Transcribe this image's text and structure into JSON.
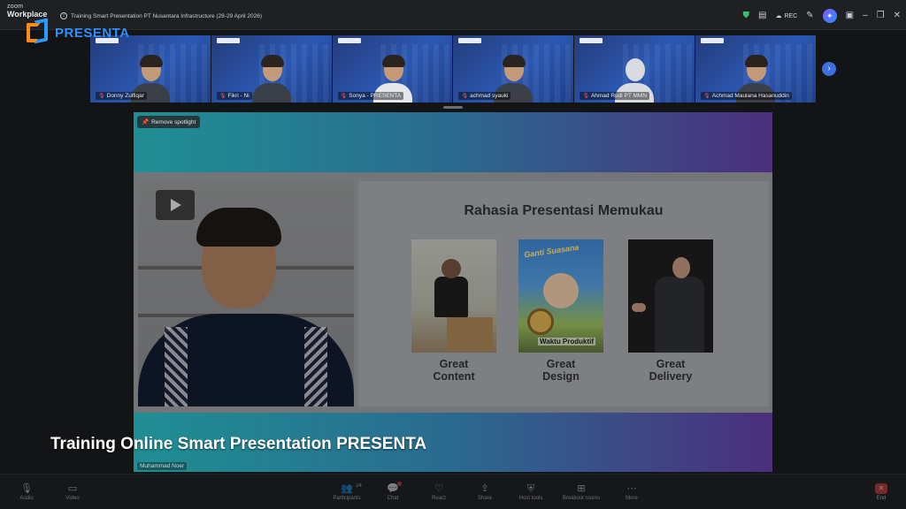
{
  "window": {
    "app_name_small": "zoom",
    "app_name": "Workplace",
    "meeting_title": "Training Smart Presentation PT Nusantara Infrastructure (28-29 April 2026)",
    "rec_label": "REC"
  },
  "overlay_logo": {
    "text": "PRESENTA"
  },
  "gallery": {
    "tiles": [
      {
        "name": "Donny Zulfiqar"
      },
      {
        "name": "Fikri - Ni"
      },
      {
        "name": "Sonya - PRESENTA"
      },
      {
        "name": "achmad syauki"
      },
      {
        "name": "Ahmad Rudi PT MMN"
      },
      {
        "name": "Achmad Maulana Hasanuddin"
      }
    ]
  },
  "spotlight": {
    "remove_label": "Remove spotlight",
    "speaker_name": "Muhammad Noer",
    "slide": {
      "title": "Rahasia Presentasi Memukau",
      "design_cover_title": "Ganti Suasana",
      "design_cover_sub": "Waktu Produktif",
      "cards": [
        {
          "label": "Great\nContent"
        },
        {
          "label": "Great\nDesign"
        },
        {
          "label": "Great\nDelivery"
        }
      ]
    }
  },
  "caption": "Training Online Smart Presentation PRESENTA",
  "toolbar": {
    "audio": "Audio",
    "video": "Video",
    "participants": "Participants",
    "participants_count": "24",
    "chat": "Chat",
    "react": "React",
    "share": "Share",
    "host_tools": "Host tools",
    "breakout_rooms": "Breakout rooms",
    "more": "More",
    "end": "End"
  },
  "colors": {
    "accent": "#2f8fff",
    "gallery_next": "#3c6fe0",
    "end_red": "#d83b3b"
  }
}
